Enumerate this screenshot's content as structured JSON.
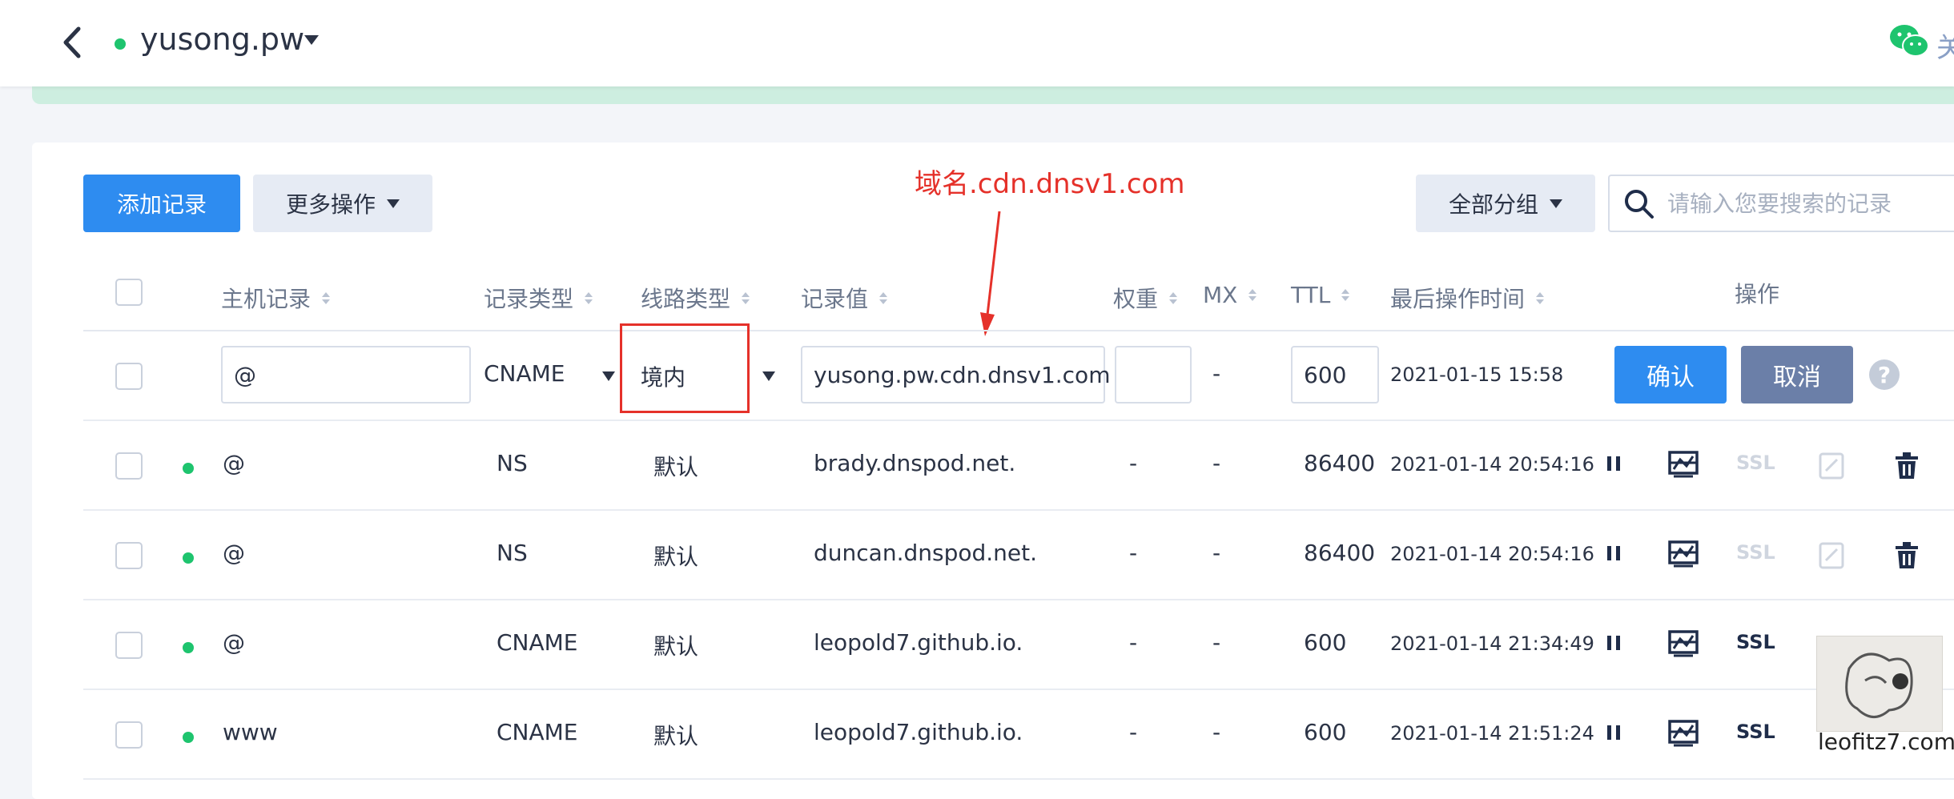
{
  "header": {
    "domain": "yusong.pw",
    "wechat_text": "关"
  },
  "toolbar": {
    "add_label": "添加记录",
    "more_label": "更多操作",
    "group_label": "全部分组",
    "search_placeholder": "请输入您要搜索的记录"
  },
  "annotation": {
    "text": "域名.cdn.dnsv1.com",
    "color": "#e5312a"
  },
  "table": {
    "headers": {
      "host": "主机记录",
      "type": "记录类型",
      "line": "线路类型",
      "value": "记录值",
      "weight": "权重",
      "mx": "MX",
      "ttl": "TTL",
      "time": "最后操作时间",
      "ops": "操作"
    },
    "edit_row": {
      "host": "@",
      "type": "CNAME",
      "line": "境内",
      "value": "yusong.pw.cdn.dnsv1.com",
      "weight": "",
      "mx": "-",
      "ttl": "600",
      "time": "2021-01-15 15:58",
      "confirm": "确认",
      "cancel": "取消",
      "help": "?"
    },
    "rows": [
      {
        "host": "@",
        "type": "NS",
        "line": "默认",
        "value": "brady.dnspod.net.",
        "weight": "-",
        "mx": "-",
        "ttl": "86400",
        "time": "2021-01-14 20:54:16",
        "ssl": "SSL"
      },
      {
        "host": "@",
        "type": "NS",
        "line": "默认",
        "value": "duncan.dnspod.net.",
        "weight": "-",
        "mx": "-",
        "ttl": "86400",
        "time": "2021-01-14 20:54:16",
        "ssl": "SSL"
      },
      {
        "host": "@",
        "type": "CNAME",
        "line": "默认",
        "value": "leopold7.github.io.",
        "weight": "-",
        "mx": "-",
        "ttl": "600",
        "time": "2021-01-14 21:34:49",
        "ssl": "SSL"
      },
      {
        "host": "www",
        "type": "CNAME",
        "line": "默认",
        "value": "leopold7.github.io.",
        "weight": "-",
        "mx": "-",
        "ttl": "600",
        "time": "2021-01-14 21:51:24",
        "ssl": "SSL"
      }
    ]
  },
  "watermark": {
    "text": "leofitz7.com"
  },
  "colors": {
    "primary": "#2e8cf0",
    "online": "#1ec46e",
    "annotation": "#e5312a"
  }
}
